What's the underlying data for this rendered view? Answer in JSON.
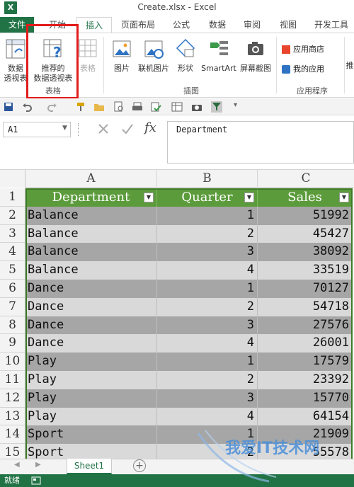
{
  "window": {
    "title": "Create.xlsx - Excel",
    "app_badge": "X"
  },
  "tabs": [
    "文件",
    "开始",
    "插入",
    "页面布局",
    "公式",
    "数据",
    "审阅",
    "视图",
    "开发工具"
  ],
  "ribbon": {
    "pivot_label_1": "数据",
    "pivot_label_2": "透视表",
    "rec_label_1": "推荐的",
    "rec_label_2": "数据透视表",
    "table_label": "表格",
    "group_tables": "表格",
    "picture": "图片",
    "online_picture": "联机图片",
    "shapes": "形状",
    "smartart": "SmartArt",
    "screenshot": "屏幕截图",
    "group_illustrations": "插图",
    "app_store": "应用商店",
    "my_apps": "我的应用",
    "group_apps": "应用程序",
    "recommended_cut": "推"
  },
  "formula_bar": {
    "name_box": "A1",
    "fx": "fx",
    "content": "Department"
  },
  "columns": [
    "A",
    "B",
    "C"
  ],
  "table_headers": [
    "Department",
    "Quarter",
    "Sales"
  ],
  "rows": [
    {
      "num": "1"
    },
    {
      "num": "2",
      "dept": "Balance",
      "q": "1",
      "sales": "51992"
    },
    {
      "num": "3",
      "dept": "Balance",
      "q": "2",
      "sales": "45427"
    },
    {
      "num": "4",
      "dept": "Balance",
      "q": "3",
      "sales": "38092"
    },
    {
      "num": "5",
      "dept": "Balance",
      "q": "4",
      "sales": "33519"
    },
    {
      "num": "6",
      "dept": "Dance",
      "q": "1",
      "sales": "70127"
    },
    {
      "num": "7",
      "dept": "Dance",
      "q": "2",
      "sales": "54718"
    },
    {
      "num": "8",
      "dept": "Dance",
      "q": "3",
      "sales": "27576"
    },
    {
      "num": "9",
      "dept": "Dance",
      "q": "4",
      "sales": "26001"
    },
    {
      "num": "10",
      "dept": "Play",
      "q": "1",
      "sales": "17579"
    },
    {
      "num": "11",
      "dept": "Play",
      "q": "2",
      "sales": "23392"
    },
    {
      "num": "12",
      "dept": "Play",
      "q": "3",
      "sales": "15770"
    },
    {
      "num": "13",
      "dept": "Play",
      "q": "4",
      "sales": "64154"
    },
    {
      "num": "14",
      "dept": "Sport",
      "q": "1",
      "sales": "21909"
    },
    {
      "num": "15",
      "dept": "Sport",
      "q": "2",
      "sales": "55578"
    }
  ],
  "sheet": {
    "name": "Sheet1"
  },
  "status": {
    "ready": "就绪"
  },
  "watermark": {
    "text": "我爱IT技术网"
  },
  "colors": {
    "excel_green": "#217346",
    "table_header": "#5b9b3b",
    "band_dark": "#a6a6a6",
    "band_light": "#d9d9d9",
    "highlight": "#e21b1b"
  }
}
